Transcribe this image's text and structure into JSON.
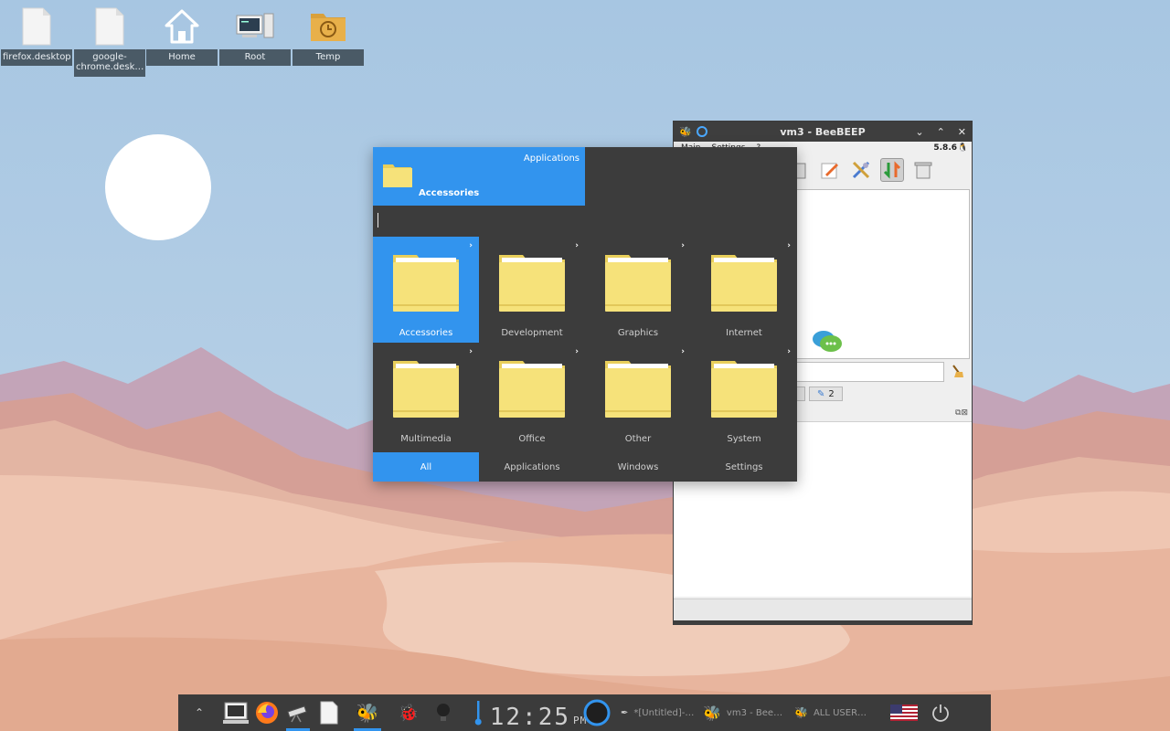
{
  "desktop": {
    "icons": [
      {
        "label": "firefox.desktop",
        "icon": "file-icon"
      },
      {
        "label": "google-chrome.desk…",
        "icon": "file-icon"
      },
      {
        "label": "Home",
        "icon": "home-icon"
      },
      {
        "label": "Root",
        "icon": "computer-icon"
      },
      {
        "label": "Temp",
        "icon": "folder-clock-icon"
      }
    ]
  },
  "beebeep": {
    "title": "vm3 - BeeBEEP",
    "version": "5.8.6",
    "menu": [
      "Main",
      "Settings",
      "?"
    ],
    "tab_count": "2"
  },
  "app_menu": {
    "header_label": "Applications",
    "current_category": "Accessories",
    "categories": [
      {
        "name": "Accessories",
        "selected": true
      },
      {
        "name": "Development",
        "selected": false
      },
      {
        "name": "Graphics",
        "selected": false
      },
      {
        "name": "Internet",
        "selected": false
      },
      {
        "name": "Multimedia",
        "selected": false
      },
      {
        "name": "Office",
        "selected": false
      },
      {
        "name": "Other",
        "selected": false
      },
      {
        "name": "System",
        "selected": false
      }
    ],
    "tabs": [
      {
        "label": "All",
        "active": true
      },
      {
        "label": "Applications",
        "active": false
      },
      {
        "label": "Windows",
        "active": false
      },
      {
        "label": "Settings",
        "active": false
      }
    ]
  },
  "taskbar": {
    "clock": {
      "time": "12:25",
      "ampm": "PM"
    },
    "tasks": [
      {
        "label": "*[Untitled]-…",
        "icon": "editor-icon"
      },
      {
        "label": "vm3 - Bee…",
        "icon": "bee-icon"
      },
      {
        "label": "ALL USER…",
        "icon": "bee-icon"
      }
    ]
  },
  "colors": {
    "accent": "#3294ee",
    "panel": "#3b3b3b",
    "folder": "#f6e27a",
    "sky": "#a8c8e4"
  }
}
